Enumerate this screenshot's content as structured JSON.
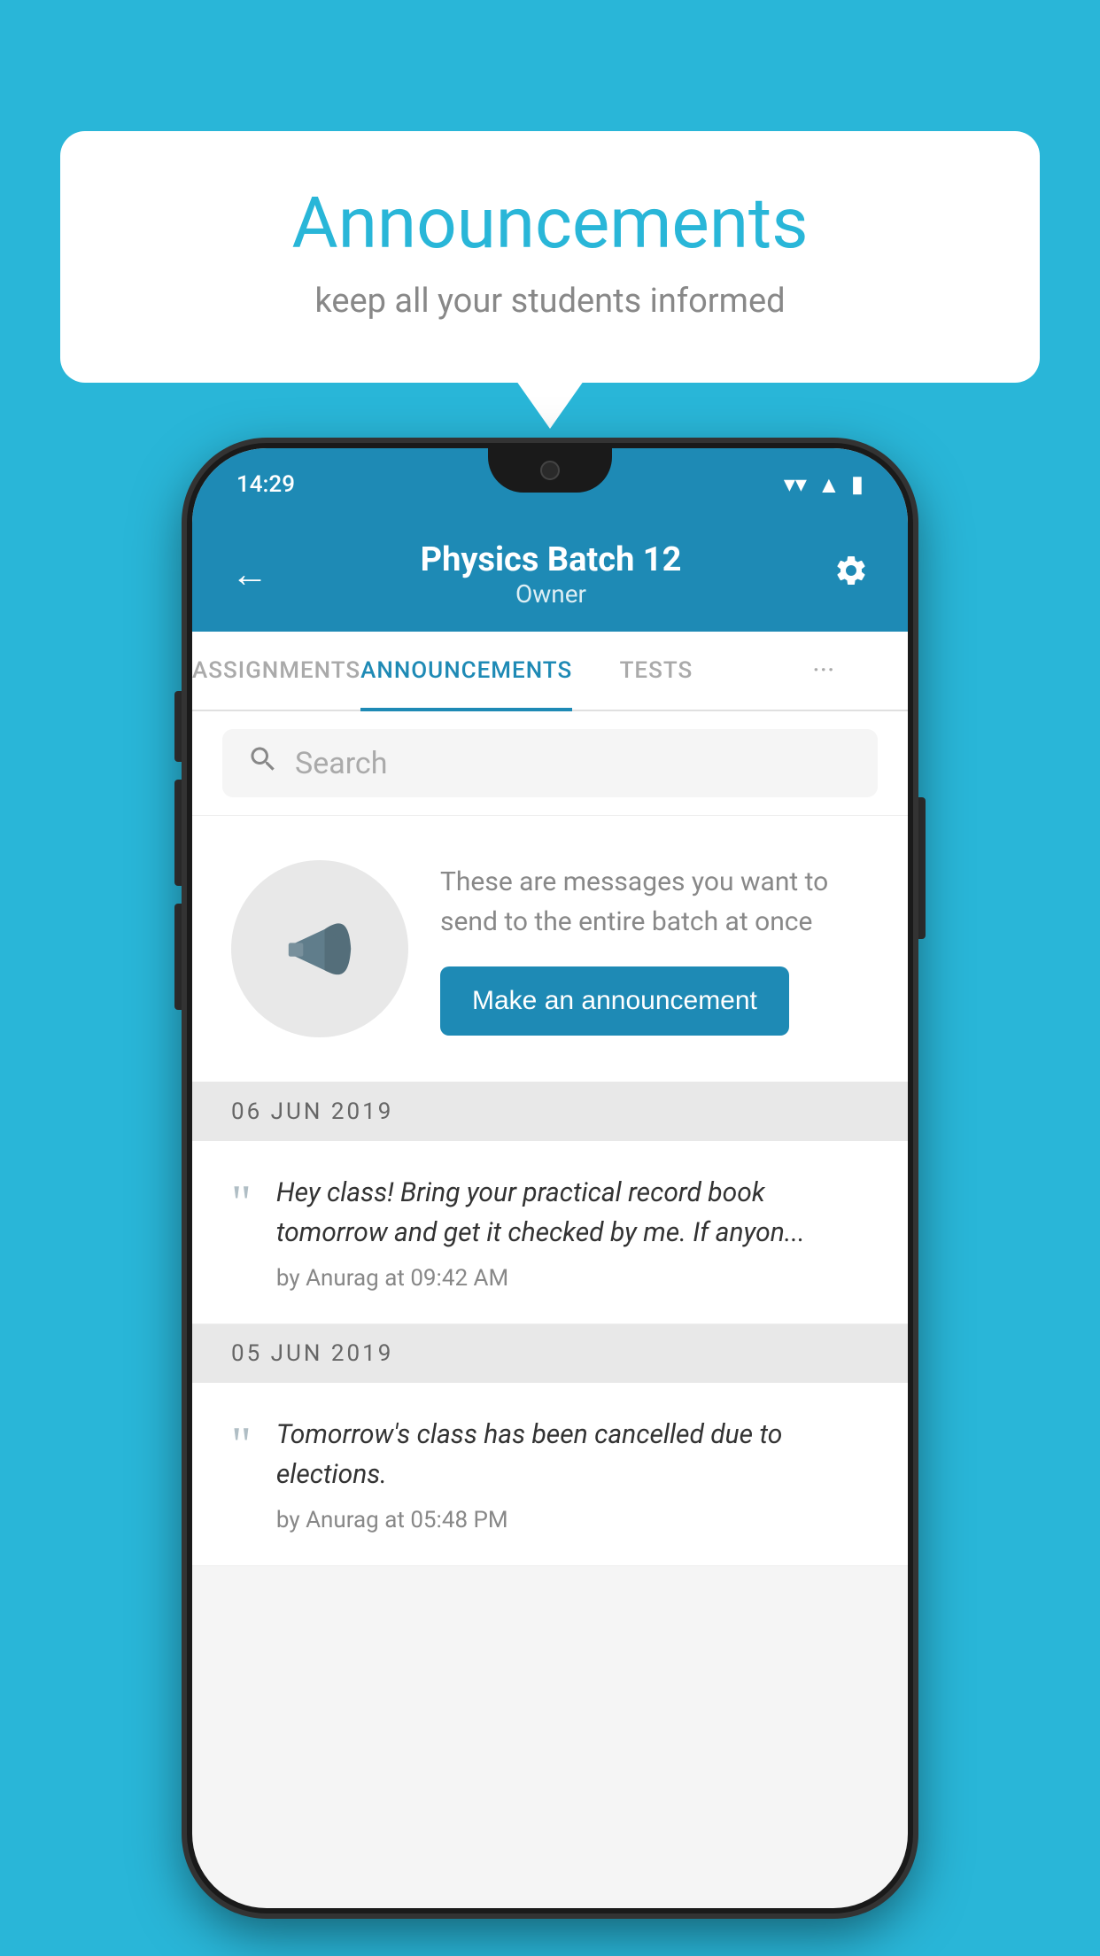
{
  "background_color": "#29b6d8",
  "speech_bubble": {
    "title": "Announcements",
    "subtitle": "keep all your students informed"
  },
  "phone": {
    "status_bar": {
      "time": "14:29"
    },
    "header": {
      "title": "Physics Batch 12",
      "subtitle": "Owner",
      "back_label": "←",
      "gear_label": "⚙"
    },
    "tabs": [
      {
        "label": "ASSIGNMENTS",
        "active": false
      },
      {
        "label": "ANNOUNCEMENTS",
        "active": true
      },
      {
        "label": "TESTS",
        "active": false
      },
      {
        "label": "···",
        "active": false
      }
    ],
    "search": {
      "placeholder": "Search"
    },
    "empty_state": {
      "description": "These are messages you want to send to the entire batch at once",
      "cta_label": "Make an announcement"
    },
    "announcements": [
      {
        "date": "06  JUN  2019",
        "text": "Hey class! Bring your practical record book tomorrow and get it checked by me. If anyon...",
        "author": "by Anurag at 09:42 AM"
      },
      {
        "date": "05  JUN  2019",
        "text": "Tomorrow's class has been cancelled due to elections.",
        "author": "by Anurag at 05:48 PM"
      }
    ]
  }
}
